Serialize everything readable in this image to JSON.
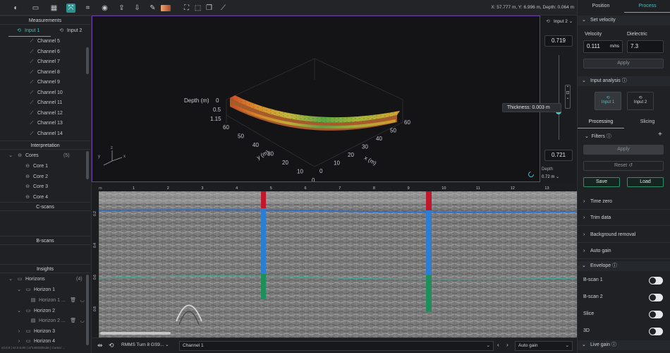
{
  "toolbar": {
    "coords": "X: 57.777 m, Y: 6.996 m, Depth: 0.064 m"
  },
  "left": {
    "measurements_title": "Measurements",
    "input1": "Input 1",
    "input2": "Input 2",
    "channels": [
      "Channel 5",
      "Channel 6",
      "Channel 7",
      "Channel 8",
      "Channel 9",
      "Channel 10",
      "Channel 11",
      "Channel 12",
      "Channel 13",
      "Channel 14"
    ],
    "interpretation_title": "Interpretation",
    "cores_label": "Cores",
    "cores_count": "(5)",
    "cores": [
      "Core 1",
      "Core 2",
      "Core 3",
      "Core 4"
    ],
    "cscans_title": "C-scans",
    "bscans_title": "B-scans",
    "insights_title": "Insights",
    "horizons_label": "Horizons",
    "horizons_count": "(4)",
    "horizon1": "Horizon 1",
    "horizon1_sub": "Horizon 1 ...",
    "horizon2": "Horizon 2",
    "horizon2_sub": "Horizon 2 ...",
    "horizon3": "Horizon 3",
    "horizon4": "Horizon 4",
    "version": "v3.0.0 | v2.0.6.85 | a71484325cde | Cursor ..."
  },
  "view3d": {
    "depth_label": "Depth (m)",
    "depth_ticks": [
      "0",
      "0.5",
      "1.15"
    ],
    "y_label": "y (m)",
    "y_ticks": [
      "60",
      "50",
      "40",
      "30",
      "20",
      "10",
      "0"
    ],
    "x_label": "x (m)",
    "x_ticks": [
      "0",
      "10",
      "20",
      "30",
      "40",
      "50",
      "60"
    ],
    "axis_x": "x",
    "axis_y": "y",
    "axis_z": "z"
  },
  "depthpanel": {
    "input_select": "Input 2",
    "top_value": "0.719",
    "bottom_value": "0.721",
    "thickness": "Thickness: 0.003 m",
    "depth_label": "Depth",
    "depth_value": "0.72 m"
  },
  "bscan": {
    "x_unit": "m",
    "x_ticks": [
      "1",
      "2",
      "3",
      "4",
      "5",
      "6",
      "7",
      "8",
      "9",
      "10",
      "11",
      "12",
      "13"
    ],
    "y_ticks": [
      "0.2",
      "0.4",
      "0.6",
      "0.8"
    ]
  },
  "bottombar": {
    "file": "RMMS Turn 8 GS9...",
    "channel": "Channel 1",
    "gain": "Auto gain"
  },
  "right": {
    "tab_position": "Position",
    "tab_process": "Process",
    "set_velocity": "Set velocity",
    "velocity_label": "Velocity",
    "dielectric_label": "Dielectric",
    "velocity_value": "0.111",
    "velocity_unit": "m/ns",
    "dielectric_value": "7.3",
    "apply": "Apply",
    "input_analysis": "Input analysis",
    "input1": "Input 1",
    "input2": "Input 2",
    "tab_processing": "Processing",
    "tab_slicing": "Slicing",
    "filters": "Filters",
    "filters_apply": "Apply",
    "reset": "Reset",
    "save": "Save",
    "load": "Load",
    "time_zero": "Time zero",
    "trim_data": "Trim data",
    "background_removal": "Background removal",
    "auto_gain": "Auto gain",
    "envelope": "Envelope",
    "bscan1": "B-scan 1",
    "bscan2": "B-scan 2",
    "slice": "Slice",
    "three_d": "3D",
    "live_gain": "Live gain"
  },
  "colors": {
    "accent": "#2e8f8f",
    "frame": "#6b3ea3",
    "core_red": "#c0182a",
    "core_blue": "#2a7fd4",
    "core_green": "#1c8f5a"
  }
}
